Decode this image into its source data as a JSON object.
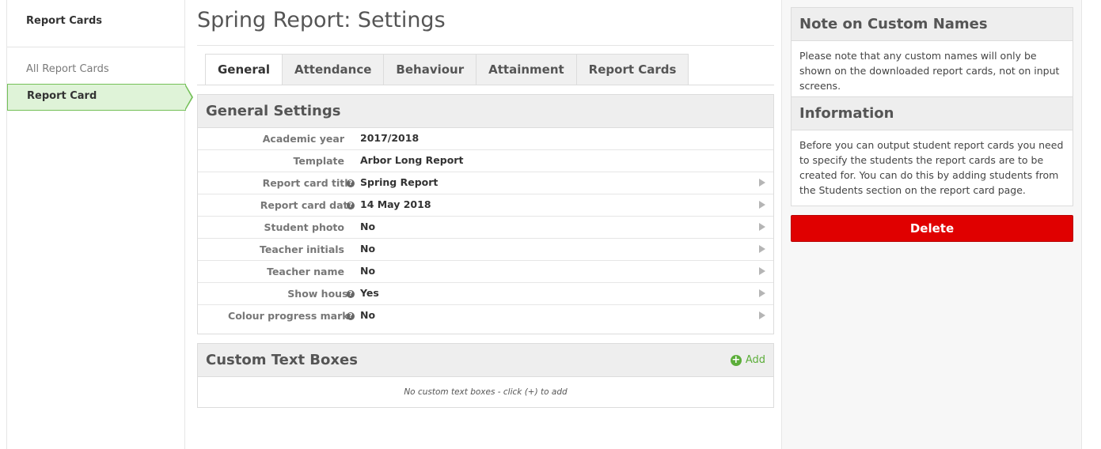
{
  "sidebar": {
    "heading": "Report Cards",
    "items": [
      {
        "label": "All Report Cards",
        "active": false
      },
      {
        "label": "Report Card",
        "active": true
      }
    ]
  },
  "page": {
    "title": "Spring Report: Settings"
  },
  "tabs": [
    {
      "label": "General",
      "active": true
    },
    {
      "label": "Attendance",
      "active": false
    },
    {
      "label": "Behaviour",
      "active": false
    },
    {
      "label": "Attainment",
      "active": false
    },
    {
      "label": "Report Cards",
      "active": false
    }
  ],
  "general_settings": {
    "title": "General Settings",
    "rows": [
      {
        "label": "Academic year",
        "value": "2017/2018",
        "help": false,
        "editable": false
      },
      {
        "label": "Template",
        "value": "Arbor Long Report",
        "help": false,
        "editable": false
      },
      {
        "label": "Report card title",
        "value": "Spring Report",
        "help": true,
        "editable": true
      },
      {
        "label": "Report card date",
        "value": "14 May 2018",
        "help": true,
        "editable": true
      },
      {
        "label": "Student photo",
        "value": "No",
        "help": false,
        "editable": true
      },
      {
        "label": "Teacher initials",
        "value": "No",
        "help": false,
        "editable": true
      },
      {
        "label": "Teacher name",
        "value": "No",
        "help": false,
        "editable": true
      },
      {
        "label": "Show house",
        "value": "Yes",
        "help": true,
        "editable": true
      },
      {
        "label": "Colour progress marks",
        "value": "No",
        "help": true,
        "editable": true
      }
    ]
  },
  "custom_text_boxes": {
    "title": "Custom Text Boxes",
    "add_label": "Add",
    "empty_message": "No custom text boxes - click (+) to add"
  },
  "note_box": {
    "title": "Note on Custom Names",
    "body": "Please note that any custom names will only be shown on the downloaded report cards, not on input screens."
  },
  "info_box": {
    "title": "Information",
    "body": "Before you can output student report cards you need to specify the students the report cards are to be created for. You can do this by adding students from the Students section on the report card page."
  },
  "delete_label": "Delete",
  "colors": {
    "accent_green": "#74c058",
    "active_bg": "#dff3d8",
    "danger": "#e00000",
    "add_green": "#5cae3a"
  }
}
